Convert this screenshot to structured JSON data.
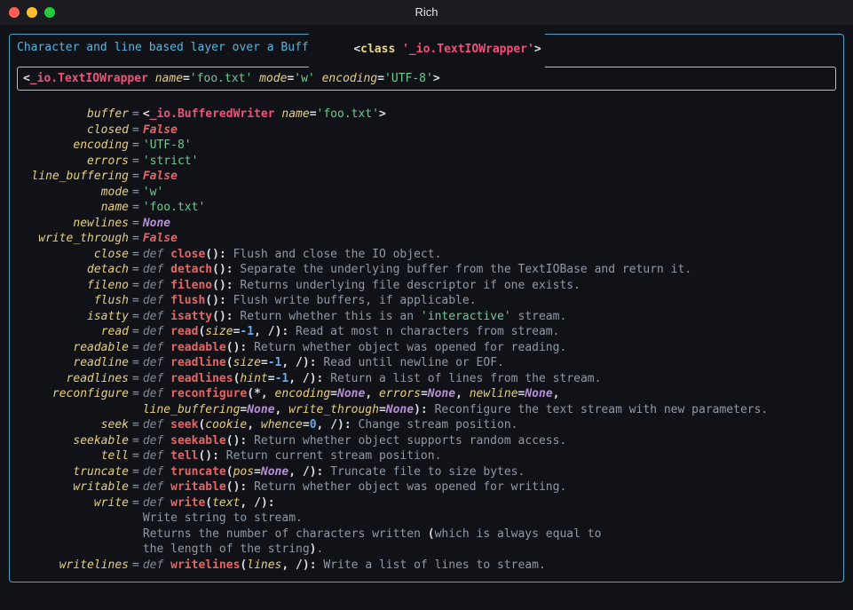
{
  "window": {
    "title": "Rich"
  },
  "header": {
    "prefix_open": "<",
    "class_kw": "class",
    "class_name": "'_io.TextIOWrapper'",
    "suffix_close": ">",
    "description": "Character and line based layer over a BufferedIOBase object, buffer."
  },
  "repr": {
    "open": "<",
    "class": "_io.TextIOWrapper",
    "attrs": [
      {
        "k": "name",
        "v": "'foo.txt'"
      },
      {
        "k": "mode",
        "v": "'w'"
      },
      {
        "k": "encoding",
        "v": "'UTF-8'"
      }
    ],
    "close": ">"
  },
  "attributes": [
    {
      "key": "buffer",
      "type": "repr",
      "repr_class": "_io.BufferedWriter",
      "repr_attrs": [
        {
          "k": "name",
          "v": "'foo.txt'"
        }
      ]
    },
    {
      "key": "closed",
      "type": "false"
    },
    {
      "key": "encoding",
      "type": "str",
      "value": "'UTF-8'"
    },
    {
      "key": "errors",
      "type": "str",
      "value": "'strict'"
    },
    {
      "key": "line_buffering",
      "type": "false"
    },
    {
      "key": "mode",
      "type": "str",
      "value": "'w'"
    },
    {
      "key": "name",
      "type": "str",
      "value": "'foo.txt'"
    },
    {
      "key": "newlines",
      "type": "none"
    },
    {
      "key": "write_through",
      "type": "false"
    }
  ],
  "methods": [
    {
      "key": "close",
      "fn": "close",
      "sig": [],
      "doc": "Flush and close the IO object."
    },
    {
      "key": "detach",
      "fn": "detach",
      "sig": [],
      "doc": "Separate the underlying buffer from the TextIOBase and return it."
    },
    {
      "key": "fileno",
      "fn": "fileno",
      "sig": [],
      "doc": "Returns underlying file descriptor if one exists."
    },
    {
      "key": "flush",
      "fn": "flush",
      "sig": [],
      "doc": "Flush write buffers, if applicable."
    },
    {
      "key": "isatty",
      "fn": "isatty",
      "sig": [],
      "doc_rich": [
        "Return whether this is an ",
        {
          "t": "str",
          "v": "'interactive'"
        },
        " stream."
      ]
    },
    {
      "key": "read",
      "fn": "read",
      "sig": [
        {
          "t": "kwarg",
          "k": "size",
          "v": {
            "t": "num",
            "v": "-1"
          }
        },
        {
          "t": "slash"
        }
      ],
      "doc": "Read at most n characters from stream."
    },
    {
      "key": "readable",
      "fn": "readable",
      "sig": [],
      "doc": "Return whether object was opened for reading."
    },
    {
      "key": "readline",
      "fn": "readline",
      "sig": [
        {
          "t": "kwarg",
          "k": "size",
          "v": {
            "t": "num",
            "v": "-1"
          }
        },
        {
          "t": "slash"
        }
      ],
      "doc": "Read until newline or EOF."
    },
    {
      "key": "readlines",
      "fn": "readlines",
      "sig": [
        {
          "t": "kwarg",
          "k": "hint",
          "v": {
            "t": "num",
            "v": "-1"
          }
        },
        {
          "t": "slash"
        }
      ],
      "doc": "Return a list of lines from the stream."
    },
    {
      "key": "reconfigure",
      "fn": "reconfigure",
      "sig": [
        {
          "t": "star"
        },
        {
          "t": "kwarg",
          "k": "encoding",
          "v": {
            "t": "none"
          }
        },
        {
          "t": "kwarg",
          "k": "errors",
          "v": {
            "t": "none"
          }
        },
        {
          "t": "kwarg",
          "k": "newline",
          "v": {
            "t": "none"
          }
        },
        {
          "t": "kwarg",
          "k": "line_buffering",
          "v": {
            "t": "none"
          }
        },
        {
          "t": "kwarg",
          "k": "write_through",
          "v": {
            "t": "none"
          }
        }
      ],
      "wrap_after": 3,
      "doc": "Reconfigure the text stream with new parameters."
    },
    {
      "key": "seek",
      "fn": "seek",
      "sig": [
        {
          "t": "arg",
          "k": "cookie"
        },
        {
          "t": "kwarg",
          "k": "whence",
          "v": {
            "t": "num",
            "v": "0"
          }
        },
        {
          "t": "slash"
        }
      ],
      "doc": "Change stream position."
    },
    {
      "key": "seekable",
      "fn": "seekable",
      "sig": [],
      "doc": "Return whether object supports random access."
    },
    {
      "key": "tell",
      "fn": "tell",
      "sig": [],
      "doc": "Return current stream position."
    },
    {
      "key": "truncate",
      "fn": "truncate",
      "sig": [
        {
          "t": "kwarg",
          "k": "pos",
          "v": {
            "t": "none"
          }
        },
        {
          "t": "slash"
        }
      ],
      "doc": "Truncate file to size bytes."
    },
    {
      "key": "writable",
      "fn": "writable",
      "sig": [],
      "doc": "Return whether object was opened for writing."
    },
    {
      "key": "write",
      "fn": "write",
      "sig": [
        {
          "t": "arg",
          "k": "text"
        },
        {
          "t": "slash"
        }
      ],
      "doc_multiline": [
        "Write string to stream.",
        [
          "Returns the number of characters written ",
          {
            "t": "bold",
            "v": "("
          },
          "which is always equal to"
        ],
        [
          "the length of the string",
          {
            "t": "bold",
            "v": ")"
          },
          "."
        ]
      ]
    },
    {
      "key": "writelines",
      "fn": "writelines",
      "sig": [
        {
          "t": "arg",
          "k": "lines"
        },
        {
          "t": "slash"
        }
      ],
      "doc": "Write a list of lines to stream."
    }
  ],
  "tokens": {
    "def": "def",
    "false": "False",
    "none": "None",
    "colon": ":",
    "slash": "/",
    "star": "*"
  }
}
